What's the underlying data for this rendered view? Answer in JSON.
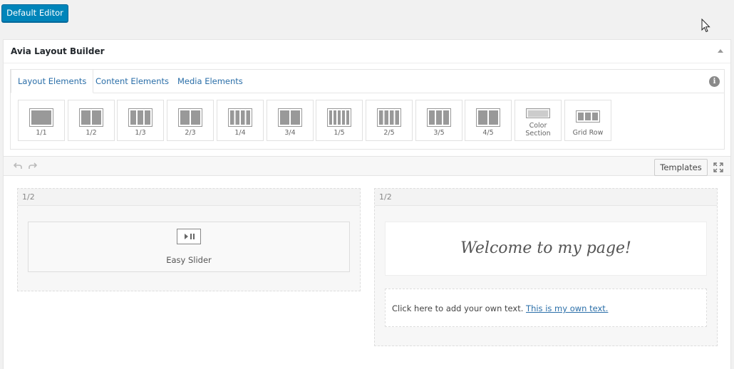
{
  "top_bar": {
    "default_editor_label": "Default Editor"
  },
  "metabox": {
    "title": "Avia Layout Builder"
  },
  "tabs": [
    {
      "label": "Layout Elements",
      "active": true
    },
    {
      "label": "Content Elements",
      "active": false
    },
    {
      "label": "Media Elements",
      "active": false
    }
  ],
  "elements": [
    {
      "label": "1/1",
      "cols": 1
    },
    {
      "label": "1/2",
      "cols": 2
    },
    {
      "label": "1/3",
      "cols": 3
    },
    {
      "label": "2/3",
      "cols": 2
    },
    {
      "label": "1/4",
      "cols": 4
    },
    {
      "label": "3/4",
      "cols": 2
    },
    {
      "label": "1/5",
      "cols": 5
    },
    {
      "label": "2/5",
      "cols": 4
    },
    {
      "label": "3/5",
      "cols": 3
    },
    {
      "label": "4/5",
      "cols": 2
    },
    {
      "label": "Color Section",
      "line1": "Color",
      "line2": "Section",
      "cols": 0
    },
    {
      "label": "Grid Row",
      "cols": 3
    }
  ],
  "toolbar": {
    "templates_label": "Templates"
  },
  "canvas": {
    "left_column": {
      "size": "1/2",
      "element_label": "Easy Slider"
    },
    "right_column": {
      "size": "1/2",
      "heading": "Welcome to my page!",
      "text_plain": "Click here to add your own text.",
      "text_link": "This is my own text."
    }
  }
}
